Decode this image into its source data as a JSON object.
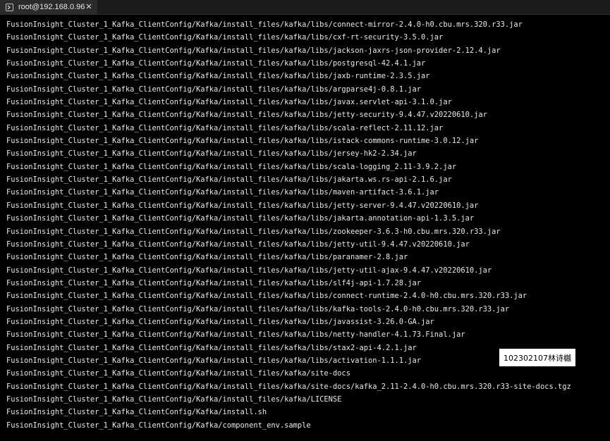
{
  "tab": {
    "title": "root@192.168.0.96",
    "icon": "terminal-icon",
    "close_icon": "close-icon"
  },
  "terminal_lines": [
    "FusionInsight_Cluster_1_Kafka_ClientConfig/Kafka/install_files/kafka/libs/connect-mirror-2.4.0-h0.cbu.mrs.320.r33.jar",
    "FusionInsight_Cluster_1_Kafka_ClientConfig/Kafka/install_files/kafka/libs/cxf-rt-security-3.5.0.jar",
    "FusionInsight_Cluster_1_Kafka_ClientConfig/Kafka/install_files/kafka/libs/jackson-jaxrs-json-provider-2.12.4.jar",
    "FusionInsight_Cluster_1_Kafka_ClientConfig/Kafka/install_files/kafka/libs/postgresql-42.4.1.jar",
    "FusionInsight_Cluster_1_Kafka_ClientConfig/Kafka/install_files/kafka/libs/jaxb-runtime-2.3.5.jar",
    "FusionInsight_Cluster_1_Kafka_ClientConfig/Kafka/install_files/kafka/libs/argparse4j-0.8.1.jar",
    "FusionInsight_Cluster_1_Kafka_ClientConfig/Kafka/install_files/kafka/libs/javax.servlet-api-3.1.0.jar",
    "FusionInsight_Cluster_1_Kafka_ClientConfig/Kafka/install_files/kafka/libs/jetty-security-9.4.47.v20220610.jar",
    "FusionInsight_Cluster_1_Kafka_ClientConfig/Kafka/install_files/kafka/libs/scala-reflect-2.11.12.jar",
    "FusionInsight_Cluster_1_Kafka_ClientConfig/Kafka/install_files/kafka/libs/istack-commons-runtime-3.0.12.jar",
    "FusionInsight_Cluster_1_Kafka_ClientConfig/Kafka/install_files/kafka/libs/jersey-hk2-2.34.jar",
    "FusionInsight_Cluster_1_Kafka_ClientConfig/Kafka/install_files/kafka/libs/scala-logging_2.11-3.9.2.jar",
    "FusionInsight_Cluster_1_Kafka_ClientConfig/Kafka/install_files/kafka/libs/jakarta.ws.rs-api-2.1.6.jar",
    "FusionInsight_Cluster_1_Kafka_ClientConfig/Kafka/install_files/kafka/libs/maven-artifact-3.6.1.jar",
    "FusionInsight_Cluster_1_Kafka_ClientConfig/Kafka/install_files/kafka/libs/jetty-server-9.4.47.v20220610.jar",
    "FusionInsight_Cluster_1_Kafka_ClientConfig/Kafka/install_files/kafka/libs/jakarta.annotation-api-1.3.5.jar",
    "FusionInsight_Cluster_1_Kafka_ClientConfig/Kafka/install_files/kafka/libs/zookeeper-3.6.3-h0.cbu.mrs.320.r33.jar",
    "FusionInsight_Cluster_1_Kafka_ClientConfig/Kafka/install_files/kafka/libs/jetty-util-9.4.47.v20220610.jar",
    "FusionInsight_Cluster_1_Kafka_ClientConfig/Kafka/install_files/kafka/libs/paranamer-2.8.jar",
    "FusionInsight_Cluster_1_Kafka_ClientConfig/Kafka/install_files/kafka/libs/jetty-util-ajax-9.4.47.v20220610.jar",
    "FusionInsight_Cluster_1_Kafka_ClientConfig/Kafka/install_files/kafka/libs/slf4j-api-1.7.28.jar",
    "FusionInsight_Cluster_1_Kafka_ClientConfig/Kafka/install_files/kafka/libs/connect-runtime-2.4.0-h0.cbu.mrs.320.r33.jar",
    "FusionInsight_Cluster_1_Kafka_ClientConfig/Kafka/install_files/kafka/libs/kafka-tools-2.4.0-h0.cbu.mrs.320.r33.jar",
    "FusionInsight_Cluster_1_Kafka_ClientConfig/Kafka/install_files/kafka/libs/javassist-3.26.0-GA.jar",
    "FusionInsight_Cluster_1_Kafka_ClientConfig/Kafka/install_files/kafka/libs/netty-handler-4.1.73.Final.jar",
    "FusionInsight_Cluster_1_Kafka_ClientConfig/Kafka/install_files/kafka/libs/stax2-api-4.2.1.jar",
    "FusionInsight_Cluster_1_Kafka_ClientConfig/Kafka/install_files/kafka/libs/activation-1.1.1.jar",
    "FusionInsight_Cluster_1_Kafka_ClientConfig/Kafka/install_files/kafka/site-docs",
    "FusionInsight_Cluster_1_Kafka_ClientConfig/Kafka/install_files/kafka/site-docs/kafka_2.11-2.4.0-h0.cbu.mrs.320.r33-site-docs.tgz",
    "FusionInsight_Cluster_1_Kafka_ClientConfig/Kafka/install_files/kafka/LICENSE",
    "FusionInsight_Cluster_1_Kafka_ClientConfig/Kafka/install.sh",
    "FusionInsight_Cluster_1_Kafka_ClientConfig/Kafka/component_env.sample"
  ],
  "watermark_label": "102302107林诗樾",
  "colors": {
    "background": "#000000",
    "text": "#e8e8e8",
    "tab_bar": "#1b1b1b",
    "tab_active": "#2b2b2b",
    "watermark_bg": "#ffffff"
  }
}
